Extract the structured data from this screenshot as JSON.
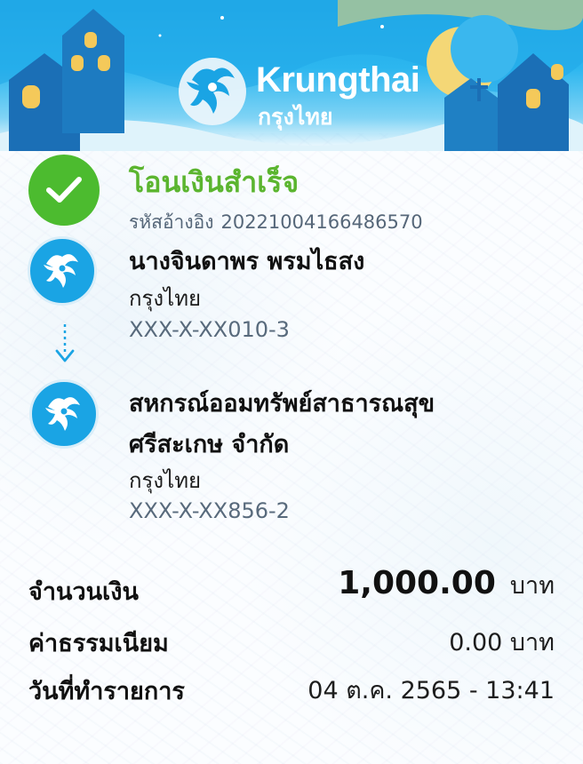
{
  "brand": {
    "name_en": "Krungthai",
    "name_th": "กรุงไทย",
    "primary_color": "#1ea7e6"
  },
  "status": {
    "title": "โอนเงินสำเร็จ",
    "ref_label": "รหัสอ้างอิง",
    "ref_number": "20221004166486570",
    "color": "#5bb52f",
    "icon": "check-icon"
  },
  "sender": {
    "name": "นางจินดาพร พรมไธสง",
    "bank": "กรุงไทย",
    "account": "XXX-X-XX010-3",
    "icon": "krungthai-logo-icon"
  },
  "receiver": {
    "name_line1": "สหกรณ์ออมทรัพย์สาธารณสุข",
    "name_line2": "ศรีสะเกษ จำกัด",
    "bank": "กรุงไทย",
    "account": "XXX-X-XX856-2",
    "icon": "krungthai-logo-icon"
  },
  "details": {
    "amount_label": "จำนวนเงิน",
    "amount_value": "1,000.00",
    "amount_unit": "บาท",
    "fee_label": "ค่าธรรมเนียม",
    "fee_value": "0.00 บาท",
    "datetime_label": "วันที่ทำรายการ",
    "datetime_value": "04 ต.ค. 2565 - 13:41"
  }
}
